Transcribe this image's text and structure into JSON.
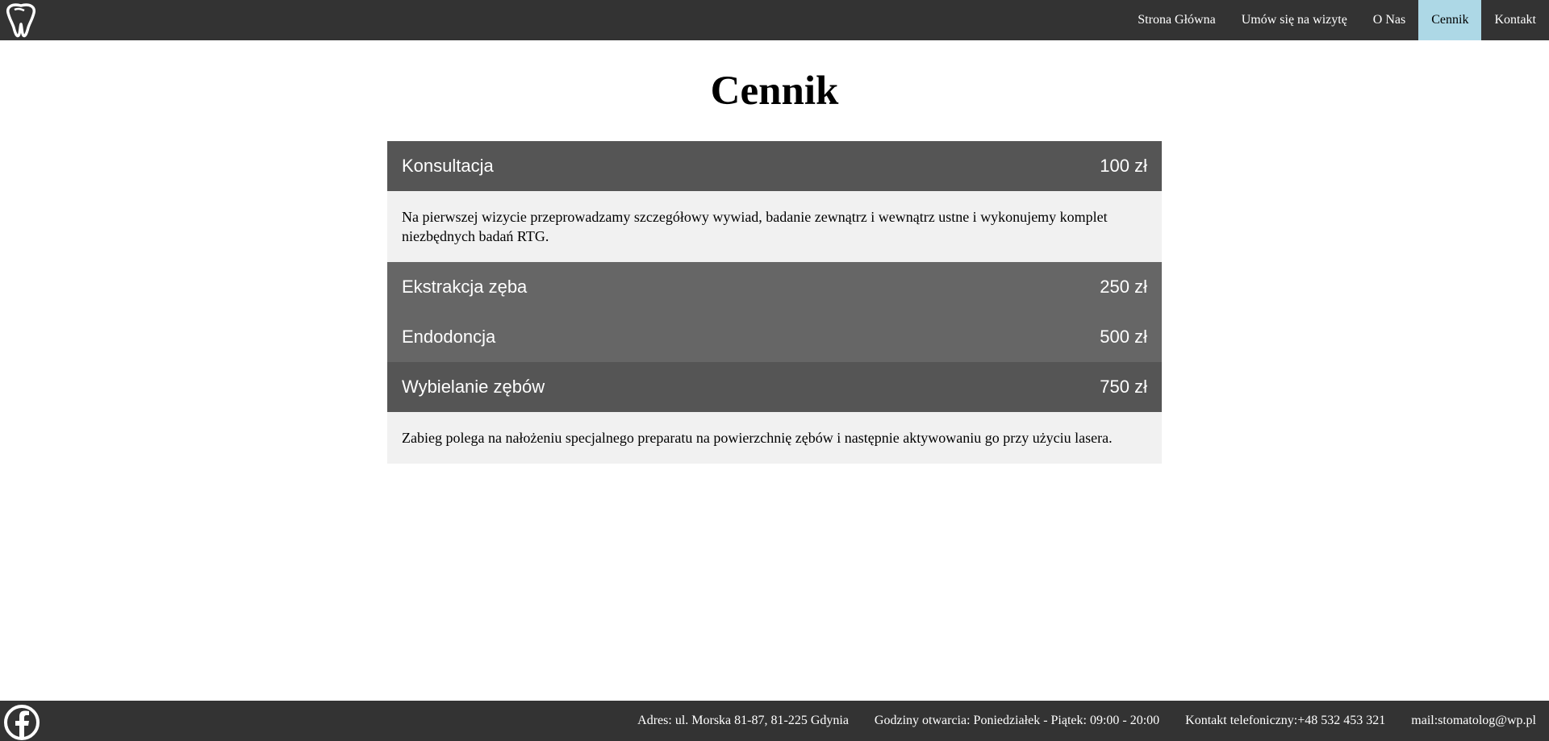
{
  "nav": {
    "logo_icon": "tooth-logo-icon",
    "items": [
      {
        "label": "Strona Główna",
        "active": false
      },
      {
        "label": "Umów się na wizytę",
        "active": false
      },
      {
        "label": "O Nas",
        "active": false
      },
      {
        "label": "Cennik",
        "active": true
      },
      {
        "label": "Kontakt",
        "active": false
      }
    ],
    "active_color": "#add8e6"
  },
  "main": {
    "title": "Cennik",
    "prices": [
      {
        "name": "Konsultacja",
        "price": "100 zł",
        "description": "Na pierwszej wizycie przeprowadzamy szczegółowy wywiad, badanie zewnątrz i wewnątrz ustne i wykonujemy komplet niezbędnych badań RTG."
      },
      {
        "name": "Ekstrakcja zęba",
        "price": "250 zł"
      },
      {
        "name": "Endodoncja",
        "price": "500 zł"
      },
      {
        "name": "Wybielanie zębów",
        "price": "750 zł",
        "description": "Zabieg polega na nałożeniu specjalnego preparatu na powierzchnię zębów i następnie aktywowaniu go przy użyciu lasera."
      }
    ]
  },
  "footer": {
    "social_icon": "facebook-icon",
    "address": "Adres: ul. Morska 81-87, 81-225 Gdynia",
    "hours": "Godziny otwarcia: Poniedziałek - Piątek: 09:00 - 20:00",
    "phone": "Kontakt telefoniczny:+48 532 453 321",
    "mail": "mail:stomatolog@wp.pl"
  },
  "colors": {
    "nav_bg": "#333333",
    "row_dark": "#555555",
    "row_mid": "#666666",
    "desc_bg": "#f1f1f1"
  }
}
